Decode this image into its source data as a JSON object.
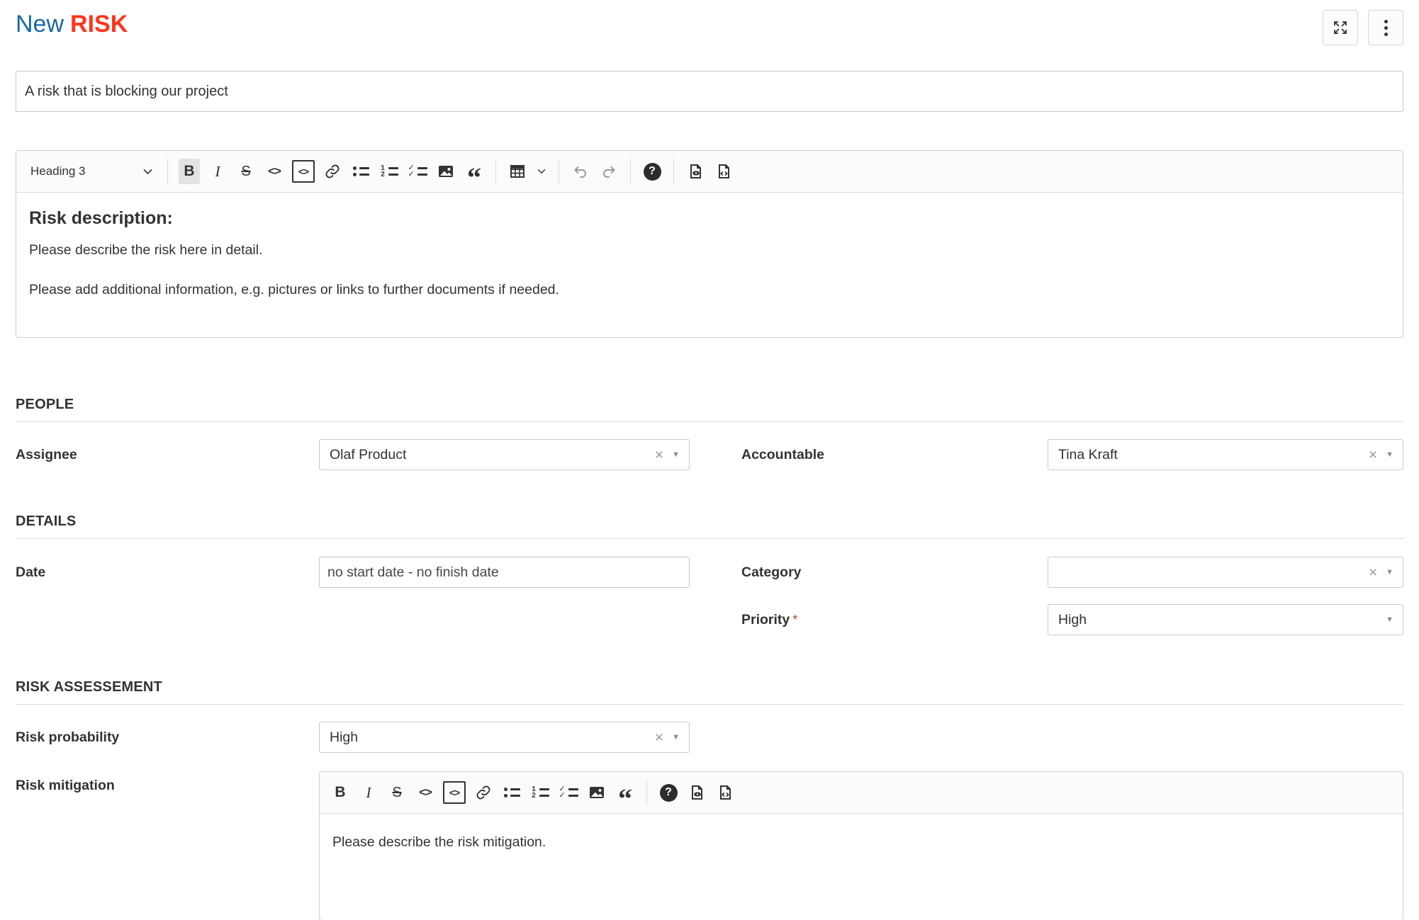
{
  "header": {
    "title_prefix": "New",
    "title_type": "RISK",
    "title_prefix_color": "#1A67A3",
    "title_type_color": "#FF351C",
    "actions": [
      "fullscreen",
      "more-options"
    ]
  },
  "subject": {
    "value": "A risk that is blocking our project"
  },
  "description_editor": {
    "heading_dropdown_label": "Heading 3",
    "toolbar_icons": [
      "heading-dropdown",
      "bold",
      "italic",
      "strikethrough",
      "inline-code",
      "code-block",
      "link",
      "bulleted-list",
      "numbered-list",
      "to-do-list",
      "insert-image",
      "block-quote",
      "insert-table",
      "undo",
      "redo",
      "help",
      "preview",
      "source-code"
    ],
    "active_buttons": [
      "bold"
    ],
    "content": {
      "heading": "Risk description:",
      "paragraphs": [
        "Please describe the risk here in detail.",
        "Please add additional information, e.g. pictures or links to further documents if needed."
      ]
    }
  },
  "sections": {
    "people": {
      "title": "PEOPLE",
      "assignee": {
        "label": "Assignee",
        "value": "Olaf Product"
      },
      "accountable": {
        "label": "Accountable",
        "value": "Tina Kraft"
      }
    },
    "details": {
      "title": "DETAILS",
      "date": {
        "label": "Date",
        "value": "no start date - no finish date"
      },
      "category": {
        "label": "Category",
        "value": ""
      },
      "priority": {
        "label": "Priority",
        "required_marker": "*",
        "value": "High"
      }
    },
    "risk_assessment": {
      "title": "RISK ASSESSEMENT",
      "probability": {
        "label": "Risk probability",
        "value": "High"
      },
      "mitigation": {
        "label": "Risk mitigation",
        "toolbar_icons": [
          "bold",
          "italic",
          "strikethrough",
          "inline-code",
          "code-block",
          "link",
          "bulleted-list",
          "numbered-list",
          "to-do-list",
          "insert-image",
          "block-quote",
          "help",
          "preview",
          "source-code"
        ],
        "placeholder_text": "Please describe the risk mitigation."
      }
    }
  },
  "widgets": {
    "clear_glyph": "×",
    "caret_glyph": "▼"
  }
}
